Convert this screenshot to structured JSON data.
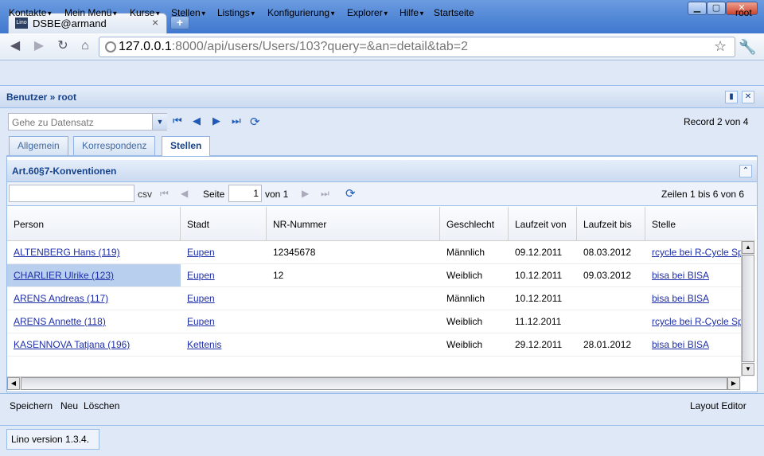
{
  "browser": {
    "tab_title": "DSBE@armand",
    "favicon_text": "Lino",
    "new_tab": "+",
    "url_host": "127.0.0.1",
    "url_rest": ":8000/api/users/Users/103?query=&an=detail&tab=2"
  },
  "menu": {
    "items": [
      "Kontakte",
      "Mein Menü",
      "Kurse",
      "Stellen",
      "Listings",
      "Konfigurierung",
      "Explorer",
      "Hilfe",
      "Startseite"
    ],
    "user": "root"
  },
  "panel": {
    "title": "Benutzer » root",
    "goto_placeholder": "Gehe zu Datensatz",
    "record": "Record 2 von 4"
  },
  "tabs": [
    "Allgemein",
    "Korrespondenz",
    "Stellen"
  ],
  "grid": {
    "title": "Art.60§7-Konventionen",
    "csv": "csv",
    "page_label": "Seite",
    "page_value": "1",
    "page_of": "von 1",
    "rows_info": "Zeilen 1 bis 6 von 6",
    "columns": [
      "Person",
      "Stadt",
      "NR-Nummer",
      "Geschlecht",
      "Laufzeit von",
      "Laufzeit bis",
      "Stelle"
    ],
    "rows": [
      [
        "ALTENBERG Hans (119)",
        "Eupen",
        "12345678",
        "Männlich",
        "09.12.2011",
        "08.03.2012",
        "rcycle bei R-Cycle Sperrgutsortierzentrum"
      ],
      [
        "CHARLIER Ulrike (123)",
        "Eupen",
        "12",
        "Weiblich",
        "10.12.2011",
        "09.03.2012",
        "bisa bei BISA"
      ],
      [
        "ARENS Andreas (117)",
        "Eupen",
        "",
        "Männlich",
        "10.12.2011",
        "",
        "bisa bei BISA"
      ],
      [
        "ARENS Annette (118)",
        "Eupen",
        "",
        "Weiblich",
        "11.12.2011",
        "",
        "rcycle bei R-Cycle Sperrgutsortierzentrum"
      ],
      [
        "KASENNOVA Tatjana (196)",
        "Kettenis",
        "",
        "Weiblich",
        "29.12.2011",
        "28.01.2012",
        "bisa bei BISA"
      ]
    ]
  },
  "actions": {
    "save": "Speichern",
    "new": "Neu",
    "delete": "Löschen",
    "layout_editor": "Layout Editor"
  },
  "status": {
    "version": "Lino version 1.3.4."
  }
}
